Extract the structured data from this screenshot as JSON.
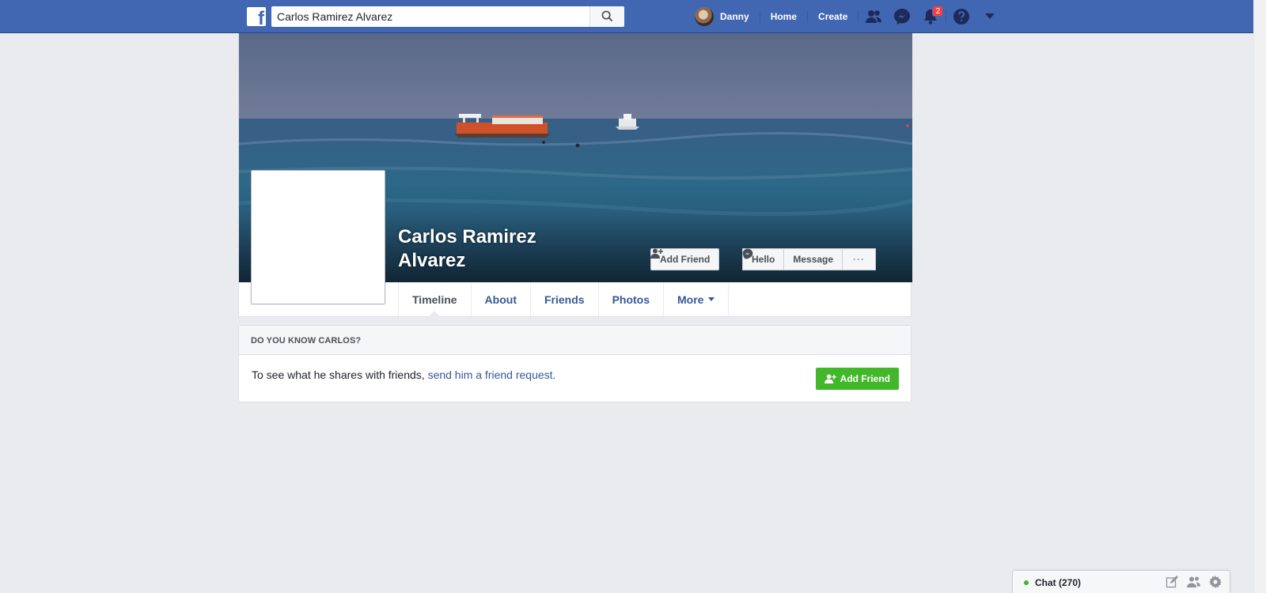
{
  "topbar": {
    "search_value": "Carlos Ramirez Alvarez",
    "user_name": "Danny",
    "home_label": "Home",
    "create_label": "Create",
    "notifications_count": "2"
  },
  "profile": {
    "name": "Carlos Ramirez Alvarez",
    "add_friend_label": "Add Friend",
    "hello_label": "Hello",
    "message_label": "Message",
    "more_actions_label": "···"
  },
  "tabs": [
    {
      "label": "Timeline"
    },
    {
      "label": "About"
    },
    {
      "label": "Friends"
    },
    {
      "label": "Photos"
    },
    {
      "label": "More"
    }
  ],
  "know_box": {
    "heading": "DO YOU KNOW CARLOS?",
    "text": "To see what he shares with friends, ",
    "link": "send him a friend request.",
    "button_label": "Add Friend"
  },
  "chat": {
    "label": "Chat (270)"
  },
  "colors": {
    "brand_blue": "#4267b2",
    "link_blue": "#365899",
    "green": "#42b72a",
    "badge_red": "#fa3e3e"
  }
}
